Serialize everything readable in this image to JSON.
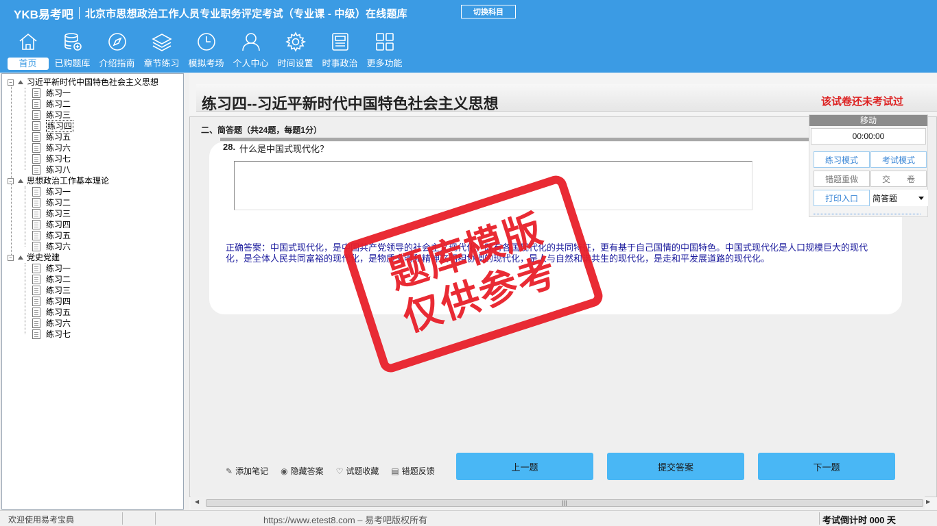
{
  "header": {
    "brand": "YKB易考吧",
    "title": "北京市思想政治工作人员专业职务评定考试（专业课 - 中级）在线题库",
    "switch_label": "切换科目"
  },
  "nav": [
    {
      "label": "首页",
      "icon": "home-icon"
    },
    {
      "label": "已购题库",
      "icon": "database-icon"
    },
    {
      "label": "介绍指南",
      "icon": "compass-icon"
    },
    {
      "label": "章节练习",
      "icon": "layers-icon"
    },
    {
      "label": "模拟考场",
      "icon": "clock-icon"
    },
    {
      "label": "个人中心",
      "icon": "user-icon"
    },
    {
      "label": "时间设置",
      "icon": "gear-icon"
    },
    {
      "label": "时事政治",
      "icon": "newspaper-icon"
    },
    {
      "label": "更多功能",
      "icon": "grid-icon"
    }
  ],
  "tree": {
    "groups": [
      {
        "label": "习近平新时代中国特色社会主义思想",
        "items": [
          "练习一",
          "练习二",
          "练习三",
          "练习四",
          "练习五",
          "练习六",
          "练习七",
          "练习八"
        ]
      },
      {
        "label": "思想政治工作基本理论",
        "items": [
          "练习一",
          "练习二",
          "练习三",
          "练习四",
          "练习五",
          "练习六"
        ]
      },
      {
        "label": "党史党建",
        "items": [
          "练习一",
          "练习二",
          "练习三",
          "练习四",
          "练习五",
          "练习六",
          "练习七"
        ]
      }
    ],
    "selected": "练习四"
  },
  "paper": {
    "title": "练习四--习近平新时代中国特色社会主义思想",
    "status": "该试卷还未考试过",
    "section": "二、简答题（共24题，每题1分）",
    "question_number": "28.",
    "question_text": "什么是中国式现代化？",
    "correct_answer": "正确答案：中国式现代化，是中国共产党领导的社会主义现代化，既有各国现代化的共同特征，更有基于自己国情的中国特色。中国式现代化是人口规模巨大的现代化，是全体人民共同富裕的现代化，是物质文明和精神文明相协调的现代化，是人与自然和谐共生的现代化，是走和平发展道路的现代化。"
  },
  "tools": {
    "note": "添加笔记",
    "hide": "隐藏答案",
    "fav": "试题收藏",
    "feedback": "错题反馈"
  },
  "buttons": {
    "prev": "上一题",
    "submit": "提交答案",
    "next": "下一题"
  },
  "control": {
    "move": "移动",
    "timer": "00:00:00",
    "practice_mode": "练习模式",
    "exam_mode": "考试模式",
    "redo_wrong": "错题重做",
    "hand_in": "交　　卷",
    "print": "打印入口",
    "type_selected": "简答题"
  },
  "stamp": {
    "line1": "题库模版",
    "line2": "仅供参考"
  },
  "status": {
    "welcome": "欢迎使用易考宝典",
    "copyright": "https://www.etest8.com – 易考吧版权所有",
    "countdown": "考试倒计时 000 天"
  },
  "colors": {
    "header_bg": "#3b9be4",
    "action_button": "#49b7f5",
    "status_red": "#dd2222",
    "answer_blue": "#1a1a9c",
    "stamp_red": "#e8202a"
  }
}
